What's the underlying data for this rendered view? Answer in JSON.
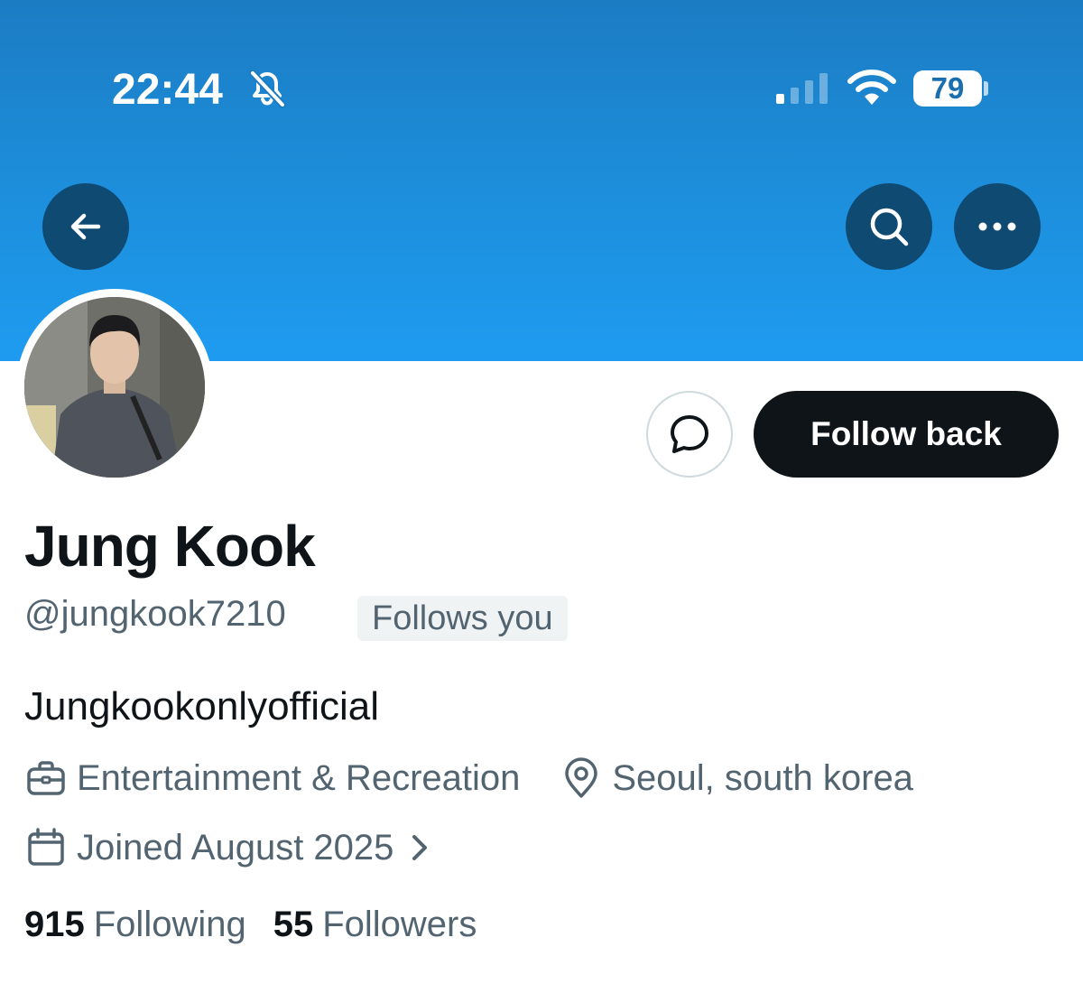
{
  "status_bar": {
    "time": "22:44",
    "battery": "79",
    "icons": [
      "bell-slash-icon",
      "signal-bars-icon",
      "wifi-icon",
      "battery-icon"
    ]
  },
  "header": {
    "icons": [
      "arrow-left-icon",
      "search-icon",
      "more-horizontal-icon"
    ]
  },
  "colors": {
    "banner_top": "#1b7cc3",
    "banner_bottom": "#1e9bf0",
    "header_button_bg": "#0f4a73",
    "follow_button_bg": "#0f1419",
    "secondary_text": "#536471",
    "badge_bg": "#eff3f4"
  },
  "actions": {
    "message_icon": "message-bubble-icon",
    "follow_back_label": "Follow back"
  },
  "profile": {
    "display_name": "Jung Kook",
    "handle": "@jungkook7210",
    "follows_you_badge": "Follows you",
    "bio": "Jungkookonlyofficial",
    "category": "Entertainment & Recreation",
    "location": "Seoul, south korea",
    "joined": "Joined August 2025",
    "following_count": "915",
    "following_label": "Following",
    "followers_count": "55",
    "followers_label": "Followers"
  }
}
